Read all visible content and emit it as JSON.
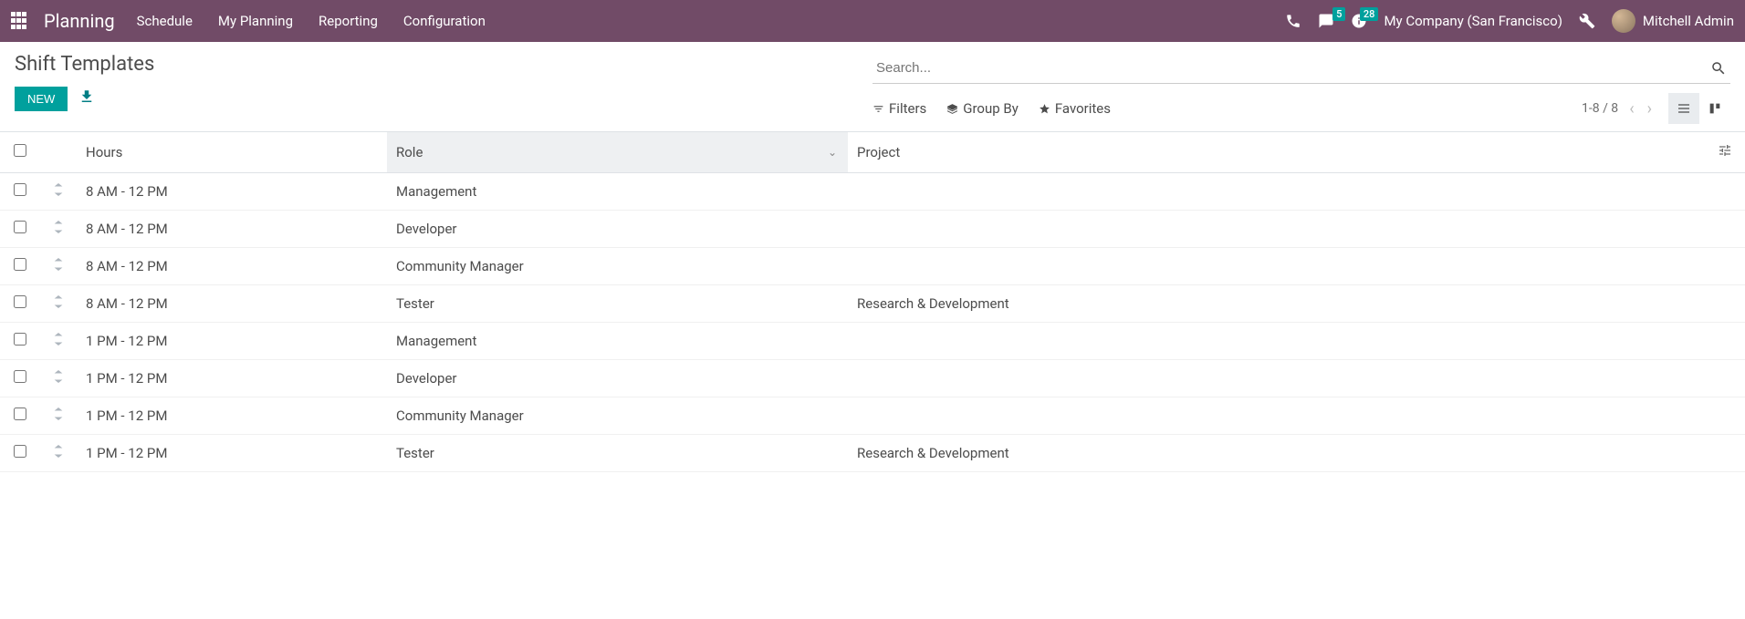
{
  "topnav": {
    "brand": "Planning",
    "menu": [
      "Schedule",
      "My Planning",
      "Reporting",
      "Configuration"
    ],
    "messages_badge": "5",
    "activities_badge": "28",
    "company": "My Company (San Francisco)",
    "user": "Mitchell Admin"
  },
  "control": {
    "title": "Shift Templates",
    "new_label": "NEW",
    "search_placeholder": "Search...",
    "filters_label": "Filters",
    "groupby_label": "Group By",
    "favorites_label": "Favorites",
    "pager": "1-8 / 8"
  },
  "columns": {
    "hours": "Hours",
    "role": "Role",
    "project": "Project"
  },
  "rows": [
    {
      "hours": "8 AM - 12 PM",
      "role": "Management",
      "project": ""
    },
    {
      "hours": "8 AM - 12 PM",
      "role": "Developer",
      "project": ""
    },
    {
      "hours": "8 AM - 12 PM",
      "role": "Community Manager",
      "project": ""
    },
    {
      "hours": "8 AM - 12 PM",
      "role": "Tester",
      "project": "Research & Development"
    },
    {
      "hours": "1 PM - 12 PM",
      "role": "Management",
      "project": ""
    },
    {
      "hours": "1 PM - 12 PM",
      "role": "Developer",
      "project": ""
    },
    {
      "hours": "1 PM - 12 PM",
      "role": "Community Manager",
      "project": ""
    },
    {
      "hours": "1 PM - 12 PM",
      "role": "Tester",
      "project": "Research & Development"
    }
  ]
}
